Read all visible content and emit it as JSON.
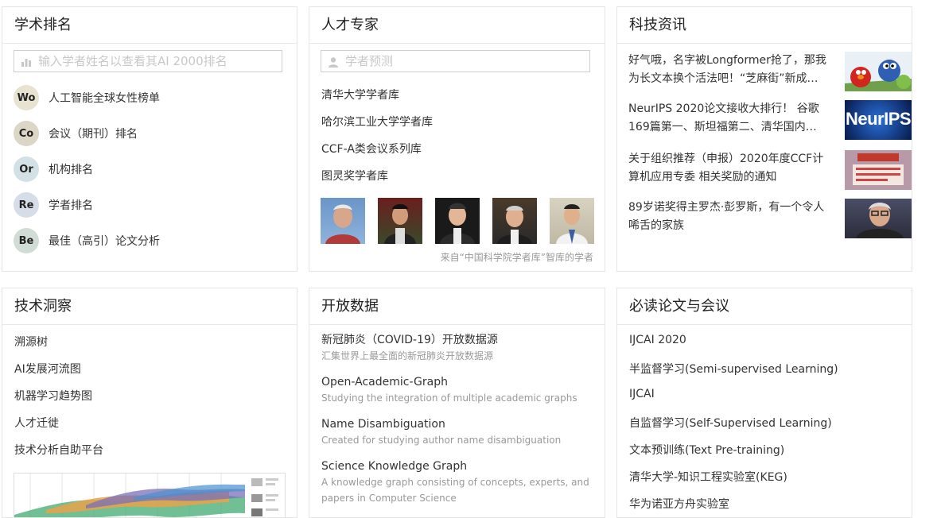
{
  "academic_ranking": {
    "title": "学术排名",
    "search_placeholder": "输入学者姓名以查看其AI 2000排名",
    "items": [
      {
        "badge": "Wo",
        "label": "人工智能全球女性榜单",
        "color": "#e7e3d0"
      },
      {
        "badge": "Co",
        "label": "会议（期刊）排名",
        "color": "#dcd6c7"
      },
      {
        "badge": "Or",
        "label": "机构排名",
        "color": "#d3e1e6"
      },
      {
        "badge": "Re",
        "label": "学者排名",
        "color": "#d6dde8"
      },
      {
        "badge": "Be",
        "label": "最佳（高引）论文分析",
        "color": "#d2dcd6"
      }
    ]
  },
  "experts": {
    "title": "人才专家",
    "search_placeholder": "学者预测",
    "links": [
      "清华大学学者库",
      "哈尔滨工业大学学者库",
      "CCF-A类会议系列库",
      "图灵奖学者库"
    ],
    "caption": "来自“中国科学院学者库”智库的学者"
  },
  "news": {
    "title": "科技资讯",
    "items": [
      {
        "text": "好气哦，名字被Longformer抢了，那我为长文本换个活法吧！“芝麻街”新成…"
      },
      {
        "text": "NeurIPS 2020论文接收大排行！ 谷歌169篇第一、斯坦福第二、清华国内…",
        "image_text": "NeurIPS"
      },
      {
        "text": "关于组织推荐（申报）2020年度CCF计算机应用专委 相关奖励的通知"
      },
      {
        "text": "89岁诺奖得主罗杰·彭罗斯，有一个令人唏舌的家族"
      }
    ]
  },
  "insight": {
    "title": "技术洞察",
    "links": [
      "溯源树",
      "AI发展河流图",
      "机器学习趋势图",
      "人才迁徙",
      "技术分析自助平台"
    ]
  },
  "open_data": {
    "title": "开放数据",
    "items": [
      {
        "title": "新冠肺炎（COVID-19）开放数据源",
        "sub": "汇集世界上最全面的新冠肺炎开放数据源"
      },
      {
        "title": "Open-Academic-Graph",
        "sub": "Studying the integration of multiple academic graphs"
      },
      {
        "title": "Name Disambiguation",
        "sub": "Created for studying author name disambiguation"
      },
      {
        "title": "Science Knowledge Graph",
        "sub": "A knowledge graph consisting of concepts, experts, and papers in Computer Science"
      }
    ]
  },
  "must_read": {
    "title": "必读论文与会议",
    "links": [
      "IJCAI 2020",
      "半监督学习(Semi-supervised Learning)",
      "IJCAI",
      "自监督学习(Self-Supervised Learning)",
      "文本预训练(Text Pre-training)",
      "清华大学-知识工程实验室(KEG)",
      "华为诺亚方舟实验室"
    ]
  }
}
